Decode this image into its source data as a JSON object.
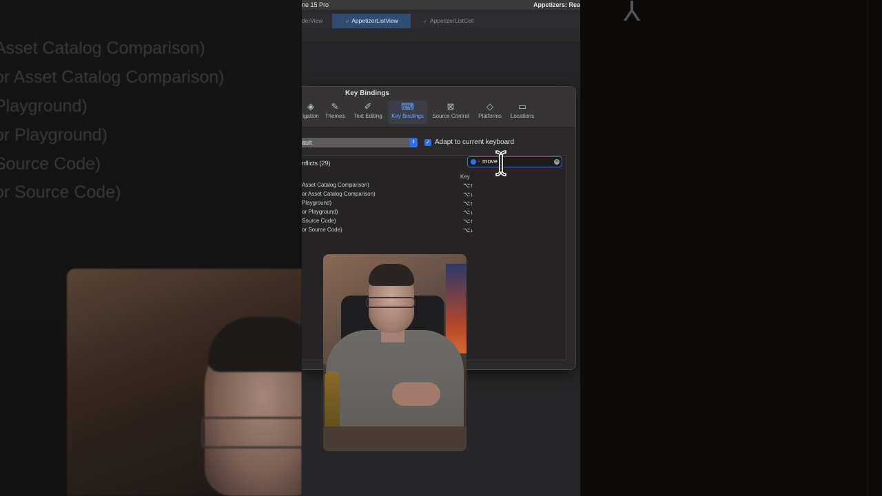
{
  "background": {
    "left_lines": [
      "Asset Catalog Comparison)",
      "or Asset Catalog Comparison)",
      "Playground)",
      "or Playground)",
      "Source Code)",
      "or Source Code)"
    ]
  },
  "xcode": {
    "titlebar_left": "ne 15 Pro",
    "titlebar_right": "Appetizers: Rea",
    "tabs": [
      {
        "label": "derView",
        "active": false
      },
      {
        "label": "AppetizerListView",
        "active": true
      },
      {
        "label": "AppetizerListCell",
        "active": false
      }
    ]
  },
  "prefs": {
    "title": "Key Bindings",
    "toolbar": [
      {
        "label": "igation",
        "icon": "navigation-icon"
      },
      {
        "label": "Themes",
        "icon": "brush-icon"
      },
      {
        "label": "Text Editing",
        "icon": "edit-icon"
      },
      {
        "label": "Key Bindings",
        "icon": "keyboard-icon",
        "selected": true
      },
      {
        "label": "Source Control",
        "icon": "source-control-icon"
      },
      {
        "label": "Platforms",
        "icon": "layers-icon"
      },
      {
        "label": "Locations",
        "icon": "drive-icon"
      }
    ],
    "keyset": "ault",
    "adapt_label": "Adapt to current keyboard",
    "adapt_checked": true,
    "conflicts": "nflicts (29)",
    "search_value": "move li",
    "key_header": "Key",
    "rows": [
      {
        "command": "Asset Catalog Comparison)",
        "key": "⌥↑"
      },
      {
        "command": "or Asset Catalog Comparison)",
        "key": "⌥↓"
      },
      {
        "command": "Playground)",
        "key": "⌥↑"
      },
      {
        "command": "or Playground)",
        "key": "⌥↓"
      },
      {
        "command": "Source Code)",
        "key": "⌥↑"
      },
      {
        "command": "or Source Code)",
        "key": "⌥↓"
      }
    ]
  }
}
